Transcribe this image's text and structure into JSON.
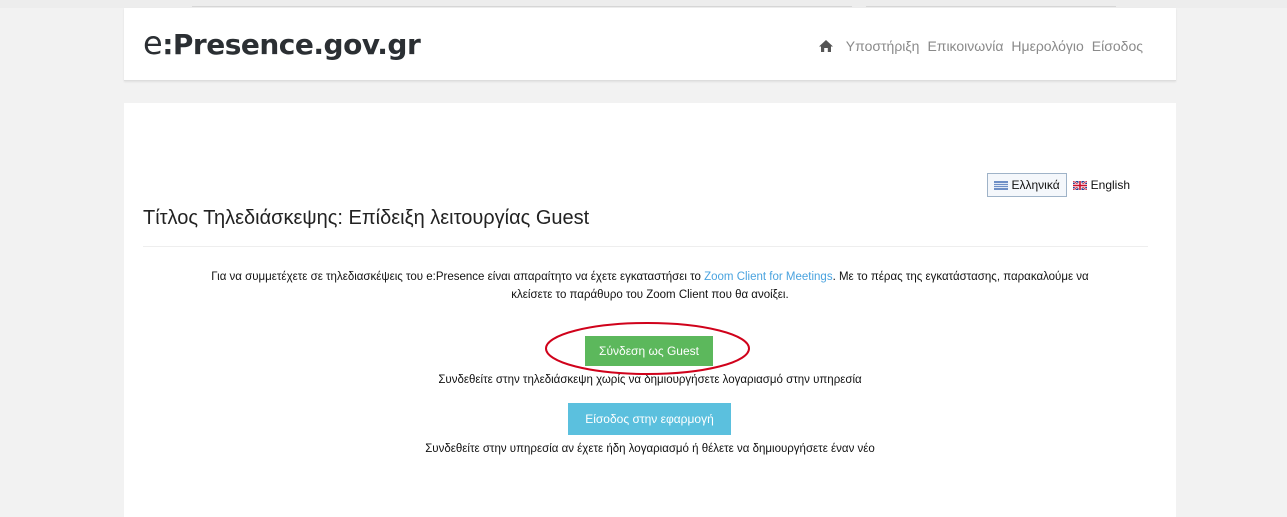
{
  "header": {
    "logo_prefix": "e",
    "logo_rest": ":Presence.gov.gr",
    "nav": {
      "support": "Υποστήριξη",
      "contact": "Επικοινωνία",
      "calendar": "Ημερολόγιο",
      "login": "Είσοδος"
    },
    "home_icon": "home-icon"
  },
  "language": {
    "greek": "Ελληνικά",
    "english": "English",
    "selected": "Ελληνικά"
  },
  "main": {
    "title": "Τίτλος Τηλεδιάσκεψης: Επίδειξη λειτουργίας Guest",
    "intro_part1": "Για να συμμετέχετε σε τηλεδιασκέψεις του e:Presence είναι απαραίτητο να έχετε εγκαταστήσει το ",
    "intro_link": "Zoom Client for Meetings",
    "intro_part2": ". Με το πέρας της εγκατάστασης, παρακαλούμε να",
    "intro_line2": "κλείσετε το παράθυρο του Zoom Client που θα ανοίξει.",
    "guest_button": "Σύνδεση ως Guest",
    "guest_description": "Συνδεθείτε στην τηλεδιάσκεψη χωρίς να δημιουργήσετε λογαριασμό στην υπηρεσία",
    "login_button": "Είσοδος στην εφαρμογή",
    "login_description": "Συνδεθείτε στην υπηρεσία αν έχετε ήδη λογαριασμό ή θέλετε να δημιουργήσετε έναν νέο"
  },
  "colors": {
    "guest_button": "#5cb85c",
    "login_button": "#5bc0de",
    "link": "#4aa3df",
    "highlight": "#d0021b"
  }
}
